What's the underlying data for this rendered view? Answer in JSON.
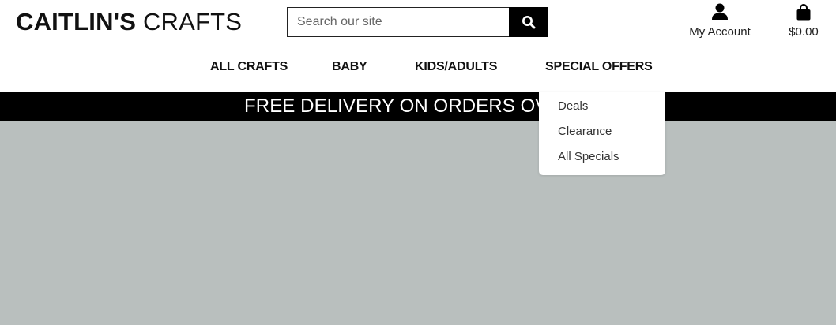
{
  "brand": {
    "part1": "CAITLIN'S",
    "part2": "CRAFTS"
  },
  "search": {
    "placeholder": "Search our site",
    "button_icon": "search-icon"
  },
  "account": {
    "label": "My Account",
    "icon": "user-icon"
  },
  "cart": {
    "total": "$0.00",
    "icon": "shopping-bag-icon"
  },
  "nav": {
    "items": [
      {
        "label": "ALL CRAFTS"
      },
      {
        "label": "BABY"
      },
      {
        "label": "KIDS/ADULTS"
      },
      {
        "label": "SPECIAL OFFERS"
      }
    ]
  },
  "banner": {
    "text": "FREE DELIVERY ON ORDERS OVER"
  },
  "dropdown": {
    "items": [
      {
        "label": "Deals"
      },
      {
        "label": "Clearance"
      },
      {
        "label": "All Specials"
      }
    ]
  },
  "colors": {
    "banner_bg": "#000000",
    "hero_bg": "#b9bfbe",
    "text": "#111111"
  }
}
